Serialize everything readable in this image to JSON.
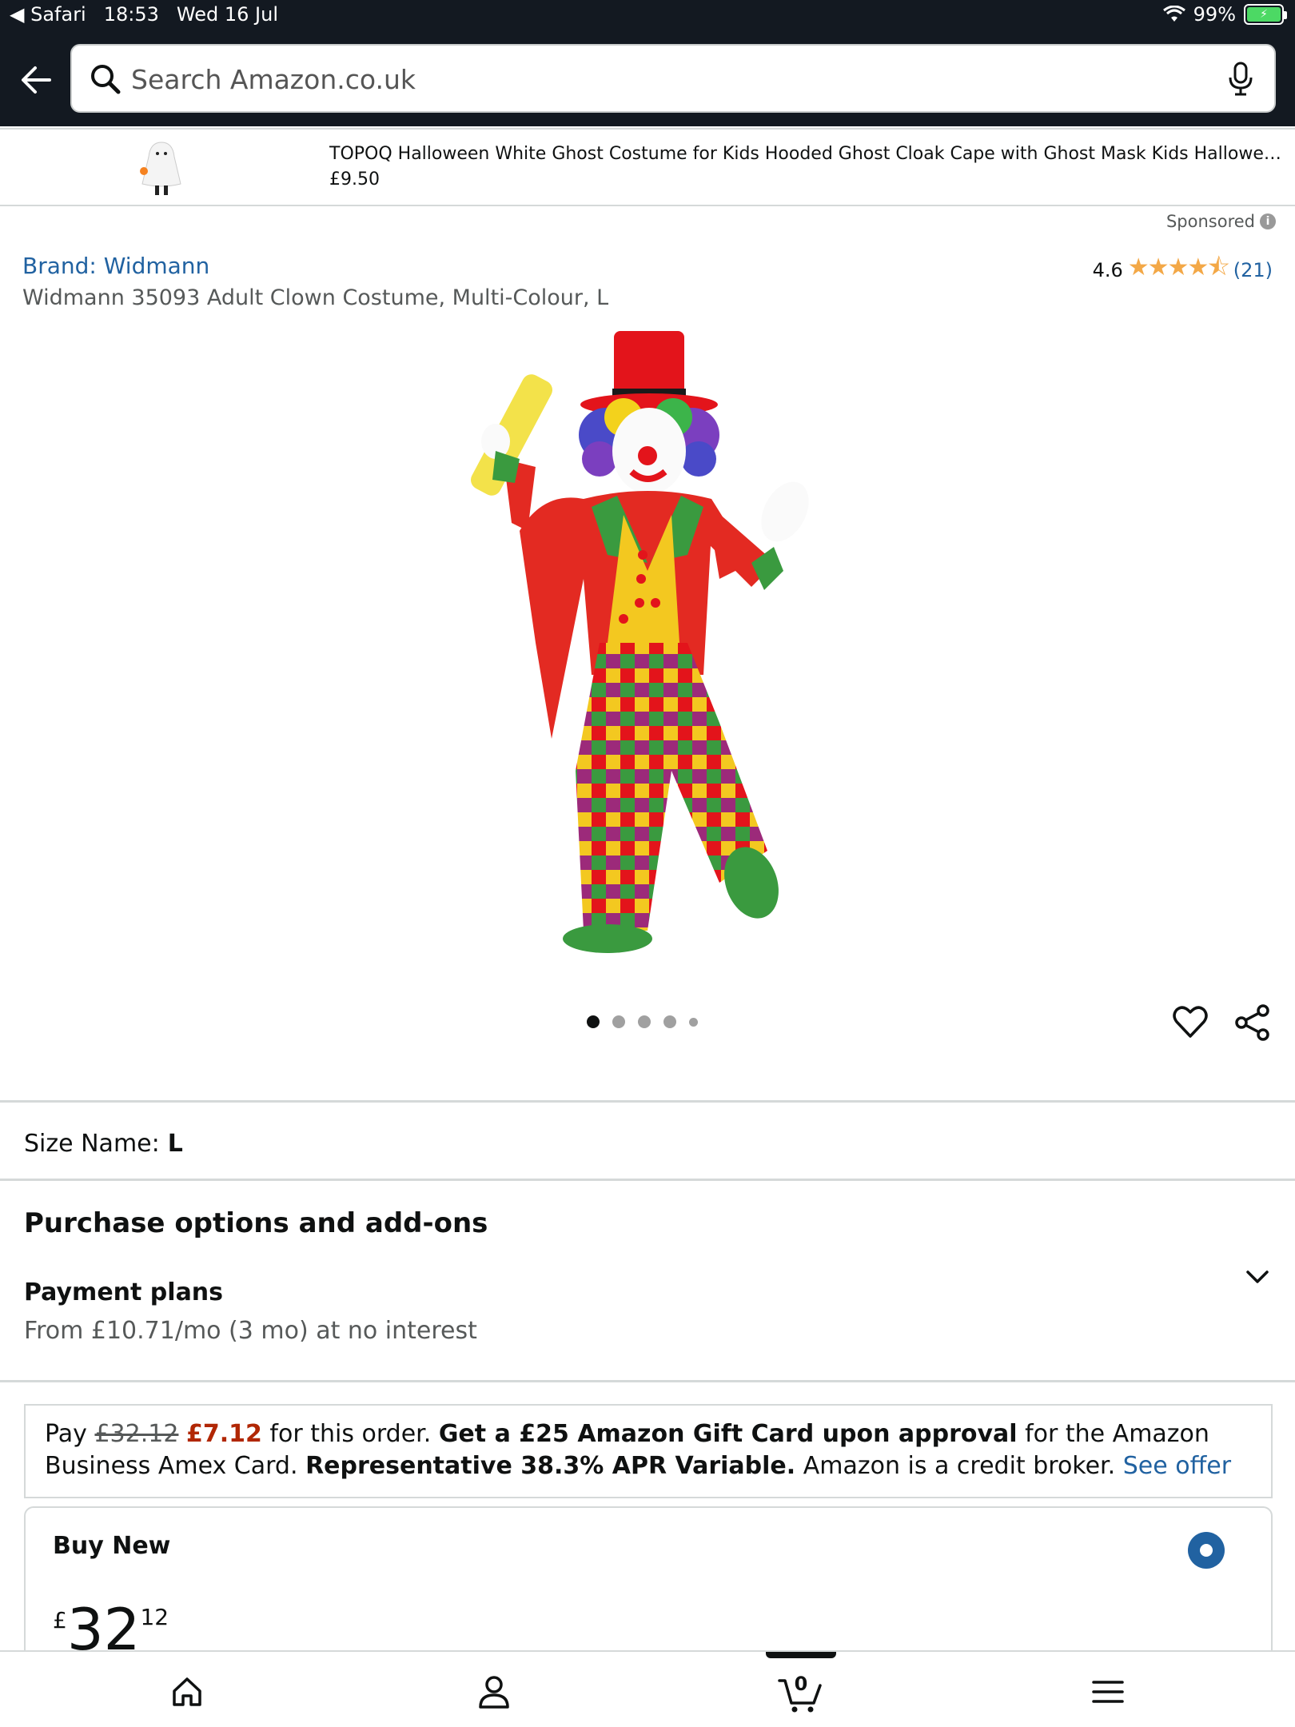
{
  "status": {
    "app": "Safari",
    "time": "18:53",
    "date": "Wed 16 Jul",
    "battery": "99%"
  },
  "search": {
    "placeholder": "Search Amazon.co.uk"
  },
  "ad": {
    "title": "TOPOQ Halloween White Ghost Costume for Kids Hooded Ghost Cloak Cape with Ghost Mask Kids Halloween Costume",
    "price": "£9.50",
    "sponsored": "Sponsored"
  },
  "product": {
    "brand": "Brand: Widmann",
    "title": "Widmann 35093 Adult Clown Costume, Multi-Colour, L",
    "rating": "4.6",
    "stars": "★★★★⯪",
    "review_count": "(21)"
  },
  "size": {
    "label": "Size Name:",
    "value": "L"
  },
  "purchase": {
    "heading": "Purchase options and add-ons",
    "payment_title": "Payment plans",
    "payment_text": "From £10.71/mo (3 mo) at no interest"
  },
  "offer": {
    "pay": "Pay",
    "old_price": "£32.12",
    "new_price": "£7.12",
    "t1": "for this order.",
    "bold1": "Get a £25 Amazon Gift Card upon approval",
    "t2": "for the Amazon Business Amex Card.",
    "bold2": "Representative 38.3% APR Variable.",
    "t3": "Amazon is a credit broker.",
    "link": "See offer"
  },
  "buy_new": {
    "label": "Buy New",
    "currency": "£",
    "whole": "32",
    "fraction": "12"
  },
  "nav": {
    "cart_count": "0"
  },
  "colors": {
    "header": "#131921",
    "link": "#2162a1",
    "deal_red": "#b12704",
    "star": "#f3a847"
  }
}
